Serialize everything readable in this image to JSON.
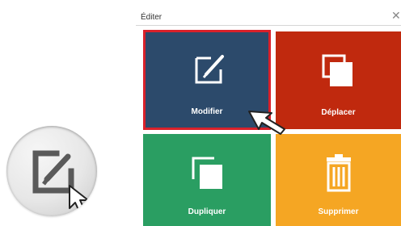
{
  "dialog": {
    "title": "Éditer",
    "close_icon": "close-icon"
  },
  "tiles": [
    {
      "label": "Modifier",
      "icon": "edit-icon",
      "color": "#2c4a6b",
      "state": "selected",
      "highlight_color": "#d9212a"
    },
    {
      "label": "Déplacer",
      "icon": "move-icon",
      "color": "#c0290e"
    },
    {
      "label": "Dupliquer",
      "icon": "duplicate-icon",
      "color": "#2a9e62"
    },
    {
      "label": "Supprimer",
      "icon": "trash-icon",
      "color": "#f5a623"
    }
  ],
  "cursor": {
    "icon": "mouse-pointer-icon"
  },
  "zoom_inset": {
    "icon": "edit-icon",
    "cursor_icon": "mouse-pointer-icon"
  }
}
